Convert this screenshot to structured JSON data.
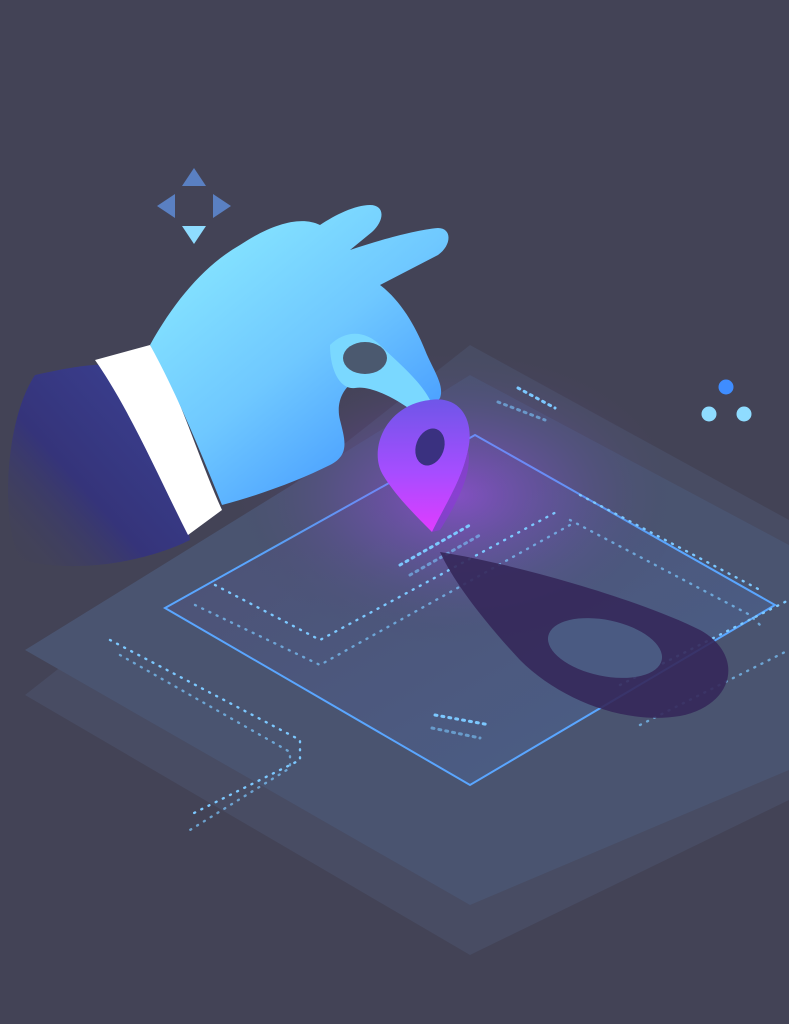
{
  "illustration": {
    "subject": "hand-placing-map-pin",
    "colors": {
      "background": "#434356",
      "platform_outer": "#4a5068",
      "platform_inner": "#4b5a7c",
      "frame_line": "#5aa6ff",
      "dots": "#7cc8ff",
      "glove_light": "#86e6ff",
      "glove_dark": "#3f93ff",
      "cuff": "#ffffff",
      "sleeve": "#3a3d8a",
      "pin_top": "#a64dff",
      "pin_bottom": "#d03cff",
      "pin_shadow": "#35285a",
      "glow": "#b04cff",
      "arrows": "#5a80c2",
      "arrow_down": "#8fdcff",
      "cluster_dot_top": "#3f8dff",
      "cluster_dots": "#8fdcff"
    },
    "icons": [
      "direction-arrows-icon",
      "map-pin-icon",
      "dot-cluster-icon"
    ]
  }
}
